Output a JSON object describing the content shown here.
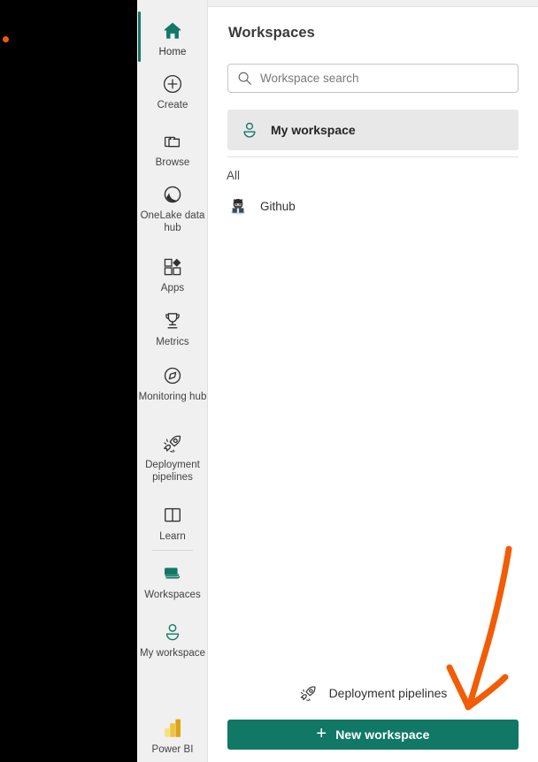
{
  "window": {
    "backdrop_color": "#000000",
    "artifact_dot_color": "#ef5a0a"
  },
  "theme": {
    "accent_green": "#117865",
    "rail_background": "#f0f0f0",
    "panel_background": "#ffffff",
    "selected_row_background": "#e8e8e8",
    "annotation_orange": "#f25c05",
    "powerbi_yellow": "#f2c811"
  },
  "nav_rail": {
    "selected_item": "Home",
    "items": [
      {
        "label": "Home",
        "icon": "home-icon",
        "selected": true
      },
      {
        "label": "Create",
        "icon": "plus-circle-icon",
        "selected": false
      },
      {
        "label": "Browse",
        "icon": "folder-icon",
        "selected": false
      },
      {
        "label": "OneLake data hub",
        "icon": "onelake-icon",
        "selected": false
      },
      {
        "label": "Apps",
        "icon": "apps-grid-icon",
        "selected": false
      },
      {
        "label": "Metrics",
        "icon": "trophy-icon",
        "selected": false
      },
      {
        "label": "Monitoring hub",
        "icon": "monitoring-gauge-icon",
        "selected": false
      },
      {
        "label": "Deployment pipelines",
        "icon": "rocket-icon",
        "selected": false
      },
      {
        "label": "Learn",
        "icon": "book-icon",
        "selected": false
      },
      {
        "label": "Workspaces",
        "icon": "workspaces-stack-icon",
        "selected": false
      },
      {
        "label": "My workspace",
        "icon": "person-icon",
        "selected": false
      },
      {
        "label": "Power BI",
        "icon": "power-bi-icon",
        "selected": false
      }
    ]
  },
  "panel": {
    "title": "Workspaces",
    "search": {
      "placeholder": "Workspace search",
      "value": "",
      "icon": "search-icon"
    },
    "pinned": {
      "label": "My workspace",
      "icon": "person-icon"
    },
    "section": {
      "label": "All",
      "items": [
        {
          "label": "Github",
          "icon": "github-avatar-icon"
        }
      ]
    },
    "footer": {
      "deployment_pipelines_label": "Deployment pipelines",
      "deployment_pipelines_icon": "rocket-icon",
      "new_workspace_label": "New workspace",
      "new_workspace_plus": "+"
    }
  },
  "annotation": {
    "type": "hand-drawn-arrow",
    "color": "#f25c05",
    "points_to": "New workspace"
  }
}
